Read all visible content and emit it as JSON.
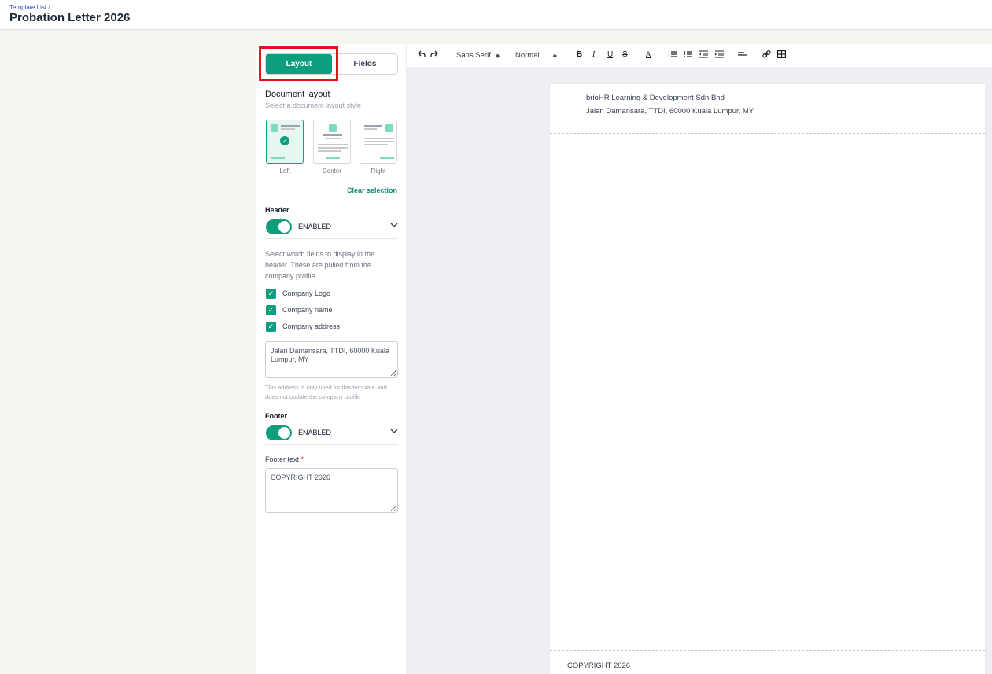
{
  "breadcrumb": {
    "link": "Template List",
    "separator": "/"
  },
  "page_title": "Probation Letter 2026",
  "panel": {
    "tabs": {
      "layout": "Layout",
      "fields": "Fields"
    },
    "document_layout": {
      "title": "Document layout",
      "subtitle": "Select a document layout style",
      "options": [
        "Left",
        "Center",
        "Right"
      ],
      "selected": "Left",
      "clear_label": "Clear selection"
    },
    "header": {
      "title": "Header",
      "toggle_label": "ENABLED",
      "description": "Select which fields to display in the header. These are pulled from the company profile",
      "fields": [
        "Company Logo",
        "Company name",
        "Company address"
      ],
      "address_value": "Jalan Damansara, TTDI, 60000 Kuala Lumpur, MY",
      "address_note": "This address is only used for this template and does not update the company profile"
    },
    "footer": {
      "title": "Footer",
      "toggle_label": "ENABLED",
      "text_label": "Footer text",
      "required_mark": "*",
      "text_value": "COPYRIGHT 2026"
    }
  },
  "toolbar": {
    "undo_icon": "undo-icon",
    "redo_icon": "redo-icon",
    "font_family": "Sans Serif",
    "font_size": "Normal",
    "bold": "B",
    "italic": "I",
    "underline": "U",
    "strike": "S",
    "font_color": "A"
  },
  "document": {
    "company_name": "brioHR Learning & Development Sdn Bhd",
    "company_address": "Jalan Damansara, TTDI, 60000 Kuala Lumpur, MY",
    "footer_text": "COPYRIGHT 2026"
  },
  "colors": {
    "accent": "#0e9e7d",
    "highlight": "#e0141c"
  }
}
